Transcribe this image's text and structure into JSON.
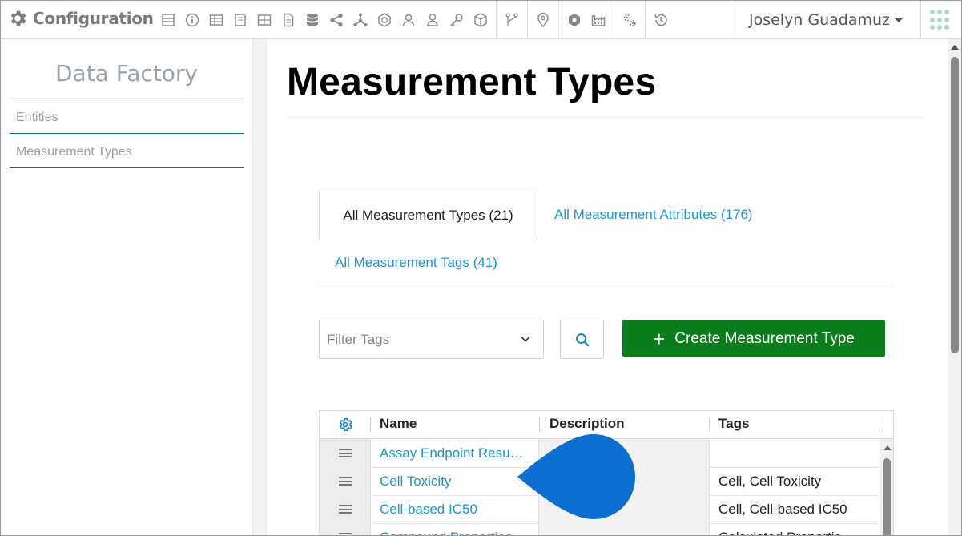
{
  "app": {
    "title": "Configuration"
  },
  "toolbar": {
    "icons": [
      "layout-icon",
      "info-icon",
      "table-icon",
      "book-icon",
      "grid-icon",
      "document-icon",
      "database-icon",
      "share-icon",
      "network-icon",
      "chemistry-icon",
      "group-icon",
      "user-icon",
      "key-icon",
      "cube-icon",
      "workflow-icon",
      "location-icon",
      "shield-icon",
      "factory-icon",
      "settings-icon",
      "history-icon"
    ]
  },
  "user": {
    "name": "Joselyn Guadamuz"
  },
  "sidebar": {
    "title": "Data Factory",
    "items": [
      {
        "label": "Entities"
      },
      {
        "label": "Measurement Types"
      }
    ]
  },
  "page": {
    "title": "Measurement Types"
  },
  "tabs": [
    {
      "label": "All Measurement Types (21)",
      "active": true
    },
    {
      "label": "All Measurement Attributes (176)"
    },
    {
      "label": "All Measurement Tags (41)"
    }
  ],
  "filter": {
    "placeholder": "Filter Tags"
  },
  "create_button": {
    "label": "Create Measurement Type"
  },
  "grid": {
    "columns": [
      "Name",
      "Description",
      "Tags"
    ],
    "rows": [
      {
        "name": "Assay Endpoint Resu…",
        "description": "",
        "tags": ""
      },
      {
        "name": "Cell Toxicity",
        "description": "",
        "tags": "Cell, Cell Toxicity"
      },
      {
        "name": "Cell-based IC50",
        "description": "",
        "tags": "Cell, Cell-based IC50"
      },
      {
        "name": "Compound Properties",
        "description": "",
        "tags": "Calculated Propertie"
      }
    ]
  },
  "colors": {
    "accent": "#1e95d3",
    "primary_button": "#0a7d1c",
    "marker": "#0a6fd0"
  }
}
